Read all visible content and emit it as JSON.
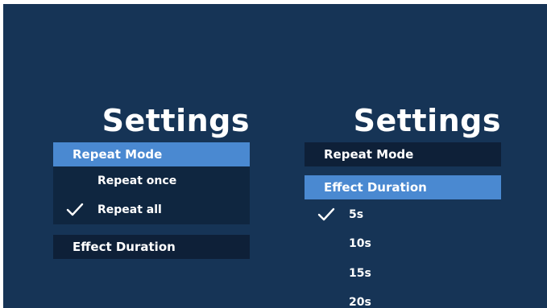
{
  "left_panel": {
    "title": "Settings",
    "repeat_mode_label": "Repeat Mode",
    "repeat_options": [
      {
        "label": "Repeat once",
        "selected": false
      },
      {
        "label": "Repeat all",
        "selected": true
      }
    ],
    "effect_duration_label": "Effect Duration"
  },
  "right_panel": {
    "title": "Settings",
    "repeat_mode_label": "Repeat Mode",
    "effect_duration_label": "Effect Duration",
    "duration_options": [
      {
        "label": "5s",
        "selected": true
      },
      {
        "label": "10s",
        "selected": false
      },
      {
        "label": "15s",
        "selected": false
      },
      {
        "label": "20s",
        "selected": false
      }
    ]
  },
  "colors": {
    "background": "#163456",
    "active_highlight": "#4a89d1",
    "menu_row": "#0e2038",
    "text": "#ffffff"
  },
  "icons": {
    "check": "check-icon"
  }
}
